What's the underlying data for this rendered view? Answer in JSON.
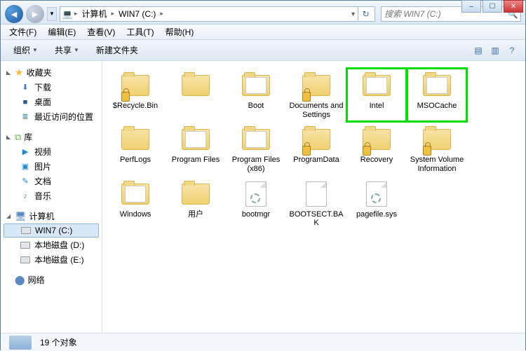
{
  "window_controls": {
    "min": "–",
    "max": "☐",
    "close": "✕"
  },
  "nav": {
    "back": "◄",
    "fwd": "►",
    "drop": "▼",
    "breadcrumb": {
      "icon": "💻",
      "seg1": "计算机",
      "seg2": "WIN7 (C:)",
      "sep": "▸"
    },
    "refresh": "↻",
    "search_placeholder": "搜索 WIN7 (C:)",
    "search_icon": "🔍"
  },
  "menu": {
    "file": "文件(F)",
    "edit": "编辑(E)",
    "view": "查看(V)",
    "tools": "工具(T)",
    "help": "帮助(H)"
  },
  "toolbar": {
    "organize": "组织",
    "share": "共享",
    "newfolder": "新建文件夹",
    "drop": "▼",
    "view_icon": "▤",
    "preview_icon": "▥",
    "help_icon": "?"
  },
  "sidebar": {
    "favorites": {
      "label": "收藏夹",
      "tri": "◣",
      "items": [
        {
          "icon": "⬇",
          "label": "下载",
          "color": "#3a78c0"
        },
        {
          "icon": "■",
          "label": "桌面",
          "color": "#2a5a9a"
        },
        {
          "icon": "≣",
          "label": "最近访问的位置",
          "color": "#4a88b0"
        }
      ]
    },
    "libraries": {
      "label": "库",
      "tri": "◣",
      "icon": "📚",
      "items": [
        {
          "icon": "▶",
          "label": "视频",
          "color": "#1a88c8"
        },
        {
          "icon": "▣",
          "label": "图片",
          "color": "#1a88c8"
        },
        {
          "icon": "✎",
          "label": "文档",
          "color": "#1a88c8"
        },
        {
          "icon": "♪",
          "label": "音乐",
          "color": "#1a88c8"
        }
      ]
    },
    "computer": {
      "label": "计算机",
      "tri": "◢",
      "icon": "💻",
      "items": [
        {
          "type": "disk",
          "label": "WIN7 (C:)",
          "selected": true
        },
        {
          "type": "disk",
          "label": "本地磁盘 (D:)"
        },
        {
          "type": "disk",
          "label": "本地磁盘 (E:)"
        }
      ]
    },
    "network": {
      "label": "网络",
      "tri": "",
      "icon": "🖧"
    }
  },
  "items": [
    {
      "name": "$Recycle.Bin",
      "type": "folder",
      "lock": true
    },
    {
      "name": "",
      "type": "folder"
    },
    {
      "name": "Boot",
      "type": "folder-open"
    },
    {
      "name": "Documents and Settings",
      "type": "folder",
      "lock": true
    },
    {
      "name": "Intel",
      "type": "folder-open",
      "highlight": true
    },
    {
      "name": "MSOCache",
      "type": "folder-open",
      "highlight": true
    },
    {
      "name": "PerfLogs",
      "type": "folder"
    },
    {
      "name": "Program Files",
      "type": "folder-open"
    },
    {
      "name": "Program Files (x86)",
      "type": "folder-open"
    },
    {
      "name": "ProgramData",
      "type": "folder",
      "lock": true
    },
    {
      "name": "Recovery",
      "type": "folder",
      "lock": true
    },
    {
      "name": "System Volume Information",
      "type": "folder",
      "lock": true
    },
    {
      "name": "Windows",
      "type": "folder-open"
    },
    {
      "name": "用户",
      "type": "folder"
    },
    {
      "name": "bootmgr",
      "type": "sysfile"
    },
    {
      "name": "BOOTSECT.BAK",
      "type": "file"
    },
    {
      "name": "pagefile.sys",
      "type": "sysfile"
    }
  ],
  "status": {
    "count": "19 个对象"
  }
}
